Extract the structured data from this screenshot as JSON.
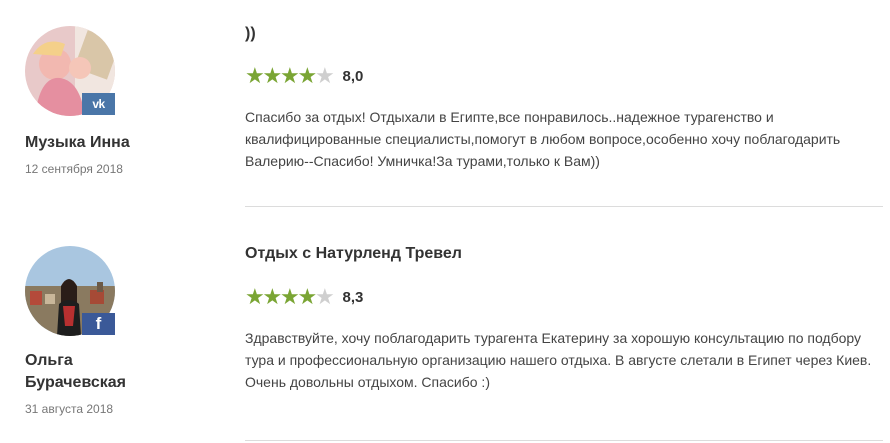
{
  "reviews": [
    {
      "author": "Музыка Инна",
      "date": "12 сентября 2018",
      "social": "vk",
      "social_label": "vk",
      "title": "))",
      "rating": "8,0",
      "stars": [
        1,
        1,
        1,
        1,
        0
      ],
      "text": "Спасибо за отдых! Отдыхали в Египте,все понравилось..надежное турагенство и квалифицированные специалисты,помогут в любом вопросе,особенно хочу поблагодарить Валерию--Спасибо! Умничка!За турами,только к Вам))"
    },
    {
      "author": "Ольга Бурачевская",
      "date": "31 августа 2018",
      "social": "facebook",
      "social_label": "f",
      "title": "Отдых с Натурленд Тревел",
      "rating": "8,3",
      "stars": [
        1,
        1,
        1,
        1,
        0.3
      ],
      "text": "Здравствуйте, хочу поблагодарить турагента Екатерину за хорошую консультацию по подбору тура и профессиональную организацию нашего отдыха. В августе слетали в Египет через Киев. Очень довольны отдыхом. Спасибо :)"
    }
  ],
  "colors": {
    "star_filled": "#7aa534",
    "star_empty": "#cfcfcf",
    "vk": "#4a76a8",
    "facebook": "#3b5998"
  }
}
